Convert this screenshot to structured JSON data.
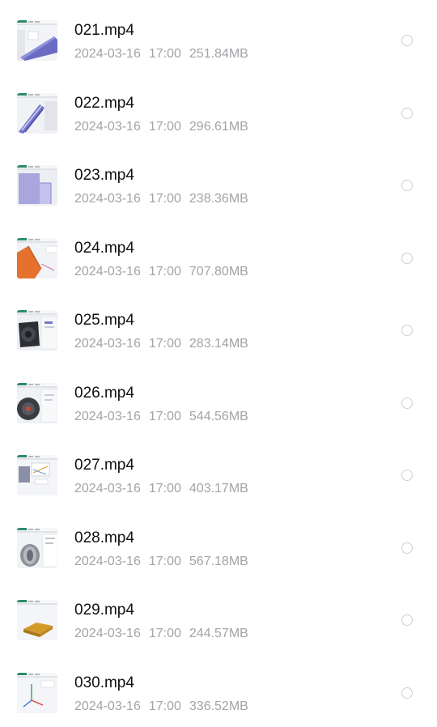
{
  "files": [
    {
      "name": "021.mp4",
      "date": "2024-03-16",
      "time": "17:00",
      "size": "251.84MB",
      "thumbnail": "thumbnail-cad-purple-surface"
    },
    {
      "name": "022.mp4",
      "date": "2024-03-16",
      "time": "17:00",
      "size": "296.61MB",
      "thumbnail": "thumbnail-cad-spiral-tool"
    },
    {
      "name": "023.mp4",
      "date": "2024-03-16",
      "time": "17:00",
      "size": "238.36MB",
      "thumbnail": "thumbnail-cad-lilac-block"
    },
    {
      "name": "024.mp4",
      "date": "2024-03-16",
      "time": "17:00",
      "size": "707.80MB",
      "thumbnail": "thumbnail-cad-orange-part"
    },
    {
      "name": "025.mp4",
      "date": "2024-03-16",
      "time": "17:00",
      "size": "283.14MB",
      "thumbnail": "thumbnail-cad-dark-housing"
    },
    {
      "name": "026.mp4",
      "date": "2024-03-16",
      "time": "17:00",
      "size": "544.56MB",
      "thumbnail": "thumbnail-cad-dark-gear"
    },
    {
      "name": "027.mp4",
      "date": "2024-03-16",
      "time": "17:00",
      "size": "403.17MB",
      "thumbnail": "thumbnail-cad-sketch-dialog"
    },
    {
      "name": "028.mp4",
      "date": "2024-03-16",
      "time": "17:00",
      "size": "567.18MB",
      "thumbnail": "thumbnail-cad-grey-cylinder"
    },
    {
      "name": "029.mp4",
      "date": "2024-03-16",
      "time": "17:00",
      "size": "244.57MB",
      "thumbnail": "thumbnail-cad-gold-plate"
    },
    {
      "name": "030.mp4",
      "date": "2024-03-16",
      "time": "17:00",
      "size": "336.52MB",
      "thumbnail": "thumbnail-cad-axes-sketch"
    }
  ],
  "colors": {
    "filename_text": "#111111",
    "meta_text": "#a3a3a8",
    "radio_border": "#cfcfd3",
    "thumbnail_toolbar": "#2e8b68"
  }
}
